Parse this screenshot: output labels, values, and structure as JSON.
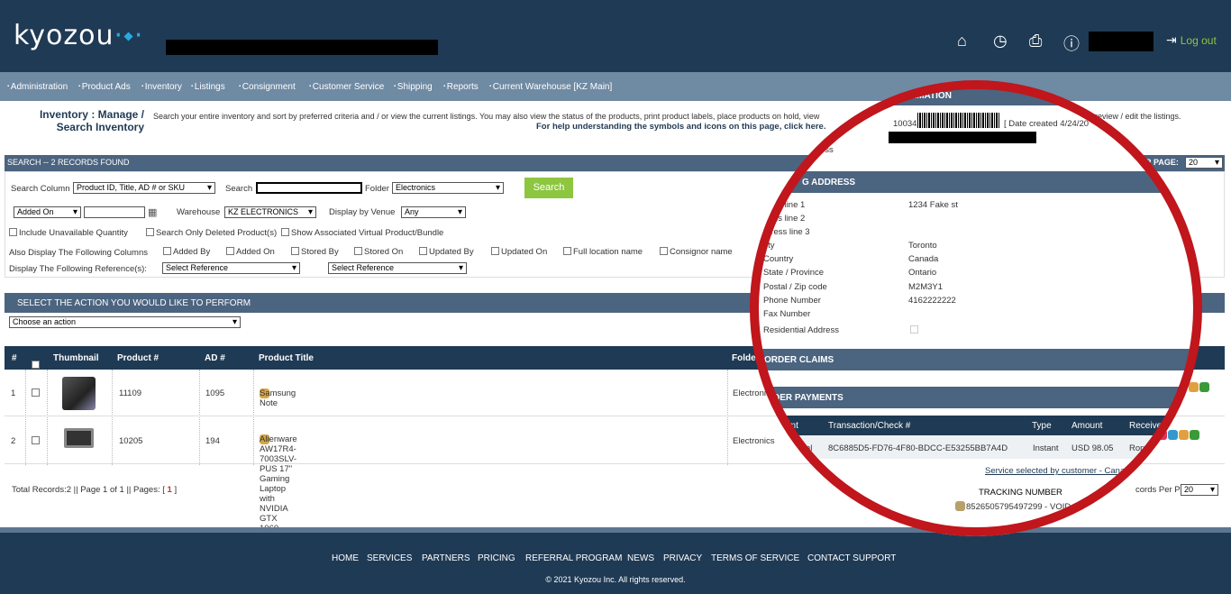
{
  "header": {
    "logo": "kyozou",
    "logout_label": "Log out",
    "icons": [
      "home-icon",
      "clock-icon",
      "print-icon",
      "help-icon",
      "logout-icon"
    ]
  },
  "nav": [
    "Administration",
    "Product Ads",
    "Inventory",
    "Listings",
    "Consignment",
    "Customer Service",
    "Shipping",
    "Reports",
    "Current Warehouse [KZ Main]"
  ],
  "page": {
    "title": "Inventory : Manage / Search Inventory",
    "description": "Search your entire inventory and sort by preferred criteria and / or view the current listings. You may also view the status of the products, print product labels, place products on hold, view",
    "description_tail": "preview / edit the listings.",
    "help": "For help understanding the symbols and icons on this page, click here."
  },
  "search": {
    "header": "SEARCH -- 2 RECORDS FOUND",
    "per_page_label": "ER PAGE:",
    "per_page_value": "20",
    "column_label": "Search Column",
    "column_value": "Product ID, Title, AD # or SKU",
    "search_label": "Search",
    "folder_label": "Folder",
    "folder_value": "Electronics",
    "button": "Search",
    "date_value": "Added On",
    "warehouse_label": "Warehouse",
    "warehouse_value": "KZ ELECTRONICS",
    "venue_label": "Display by Venue",
    "venue_value": "Any",
    "opt_unavailable": "Include Unavailable Quantity",
    "opt_deleted": "Search Only Deleted Product(s)",
    "opt_virtual": "Show Associated Virtual Product/Bundle",
    "also_label": "Also Display The Following Columns",
    "columns": [
      "Added By",
      "Added On",
      "Stored By",
      "Stored On",
      "Updated By",
      "Updated On",
      "Full location name",
      "Consignor name"
    ],
    "ref_label": "Display The Following Reference(s):",
    "ref1": "Select Reference",
    "ref2": "Select Reference"
  },
  "action": {
    "header": "SELECT THE ACTION YOU WOULD LIKE TO PERFORM",
    "value": "Choose an action"
  },
  "table": {
    "headers": [
      "#",
      "Thumbnail",
      "Product #",
      "AD #",
      "Product Title",
      "Folde"
    ],
    "rows": [
      {
        "num": "1",
        "product": "11109",
        "ad": "1095",
        "title": "Samsung Note",
        "folder": "Electronic"
      },
      {
        "num": "2",
        "product": "10205",
        "ad": "194",
        "title": "Alienware AW17R4-7003SLV-PUS 17\" Gaming Laptop with NVIDIA GTX 1060",
        "folder": "Electronics"
      }
    ]
  },
  "pager": {
    "total": "Total Records:2 || Page 1 of 1 || Pages: [",
    "page": "1",
    "close": "]",
    "per_page_label": "cords Per Page:",
    "per_page_value": "20"
  },
  "footer": {
    "links": [
      "HOME",
      "SERVICES",
      "PARTNERS",
      "PRICING",
      "REFERRAL PROGRAM",
      "NEWS",
      "PRIVACY",
      "TERMS OF SERVICE",
      "CONTACT SUPPORT"
    ],
    "copyright": "© 2021 Kyozou Inc. All rights reserved."
  },
  "popup": {
    "info_title": "RMATION",
    "order_id": "10034",
    "date_created": "[ Date created  4/24/20",
    "address_partial": "ess",
    "shipping_title": "G ADDRESS",
    "fields": [
      {
        "label": "ress line 1",
        "value": "1234 Fake st"
      },
      {
        "label": "ress line 2",
        "value": ""
      },
      {
        "label": "dress line 3",
        "value": ""
      },
      {
        "label": "ity",
        "value": "Toronto"
      },
      {
        "label": "Country",
        "value": "Canada"
      },
      {
        "label": "State / Province",
        "value": "Ontario"
      },
      {
        "label": "Postal / Zip code",
        "value": "M2M3Y1"
      },
      {
        "label": "Phone Number",
        "value": "4162222222"
      },
      {
        "label": "Fax Number",
        "value": ""
      },
      {
        "label": "Residential Address",
        "value": ""
      }
    ],
    "claims_title": "ORDER CLAIMS",
    "payments_title": "DER PAYMENTS",
    "pay_headers": [
      "ant",
      "Transaction/Check #",
      "Type",
      "Amount",
      "Receive"
    ],
    "pay_row": {
      "account": "al",
      "txn": "8C6885D5-FD76-4F80-BDCC-E53255BB7A4D",
      "type": "Instant",
      "amount": "USD 98.05",
      "received": "Ron"
    },
    "service": "Service selected by customer - Cana",
    "tracking_label": "TRACKING NUMBER",
    "tracking_value": "8526505795497299 - VOID"
  }
}
